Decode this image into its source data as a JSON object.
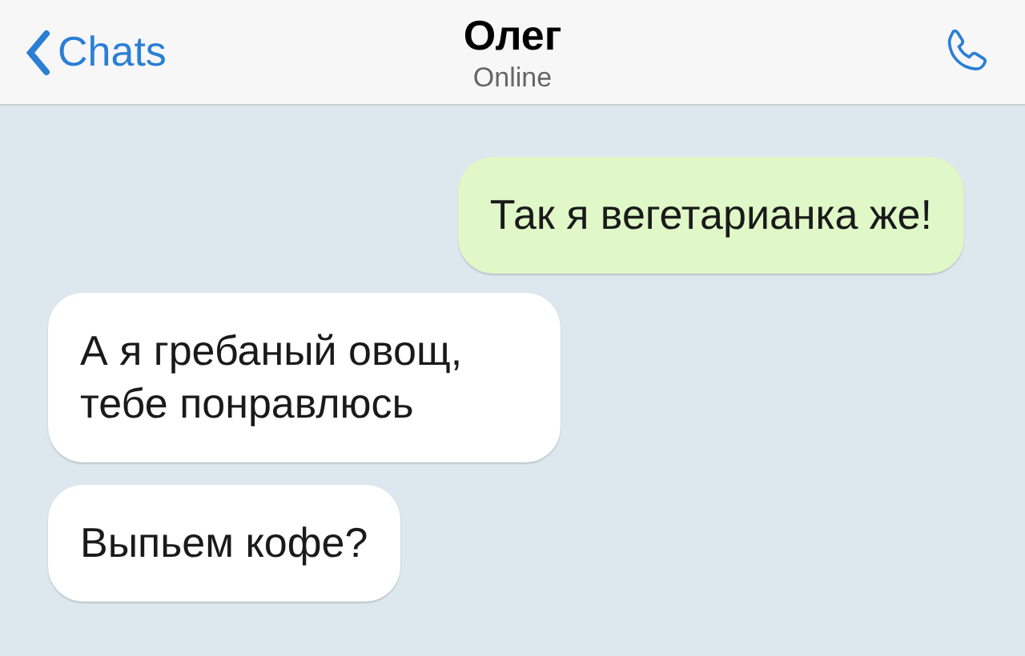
{
  "header": {
    "back_label": "Chats",
    "title": "Олег",
    "status": "Online"
  },
  "messages": [
    {
      "kind": "outgoing",
      "text": "Так я вегетарианка же!"
    },
    {
      "kind": "incoming",
      "text": "А я гребаный овощ, тебе понравлюсь"
    },
    {
      "kind": "incoming",
      "text": "Выпьем кофе?"
    }
  ]
}
